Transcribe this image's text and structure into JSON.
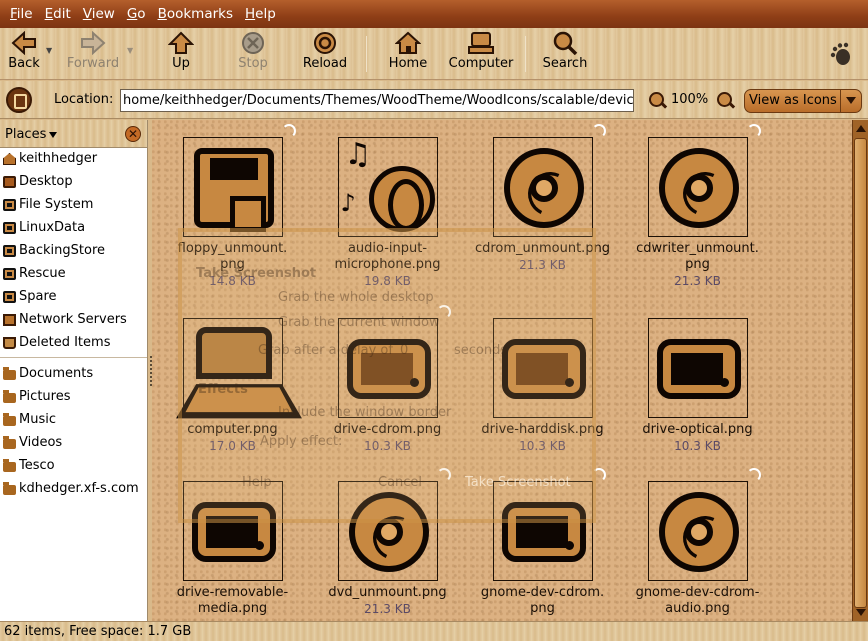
{
  "menubar": {
    "items": [
      {
        "accel": "F",
        "rest": "ile"
      },
      {
        "accel": "E",
        "rest": "dit"
      },
      {
        "accel": "V",
        "rest": "iew"
      },
      {
        "accel": "G",
        "rest": "o"
      },
      {
        "accel": "B",
        "rest": "ookmarks"
      },
      {
        "accel": "H",
        "rest": "elp"
      }
    ]
  },
  "toolbar": {
    "back": "Back",
    "forward": "Forward",
    "up": "Up",
    "stop": "Stop",
    "reload": "Reload",
    "home": "Home",
    "computer": "Computer",
    "search": "Search"
  },
  "location": {
    "label": "Location:",
    "path": "home/keithhedger/Documents/Themes/WoodTheme/WoodIcons/scalable/devices",
    "zoom": "100%",
    "view_mode": "View as Icons"
  },
  "sidebar": {
    "title": "Places",
    "items": [
      {
        "label": "keithhedger",
        "icon": "home-icon"
      },
      {
        "label": "Desktop",
        "icon": "desktop-icon"
      },
      {
        "label": "File System",
        "icon": "drive-icon"
      },
      {
        "label": "LinuxData",
        "icon": "drive-icon"
      },
      {
        "label": "BackingStore",
        "icon": "drive-icon"
      },
      {
        "label": "Rescue",
        "icon": "drive-icon"
      },
      {
        "label": "Spare",
        "icon": "drive-icon"
      },
      {
        "label": "Network Servers",
        "icon": "network-icon"
      },
      {
        "label": "Deleted Items",
        "icon": "trash-icon"
      }
    ],
    "bookmarks": [
      "Documents",
      "Pictures",
      "Music",
      "Videos",
      "Tesco",
      "kdhedger.xf-s.com"
    ]
  },
  "files": [
    {
      "name1": "floppy_unmount.",
      "name2": "png",
      "size": "14.8 KB",
      "icon": "floppy-icon"
    },
    {
      "name1": "audio-input-",
      "name2": "microphone.png",
      "size": "19.8 KB",
      "icon": "audio-icon"
    },
    {
      "name1": "cdrom_unmount.png",
      "name2": "",
      "size": "21.3 KB",
      "icon": "disc-icon"
    },
    {
      "name1": "cdwriter_unmount.",
      "name2": "png",
      "size": "21.3 KB",
      "icon": "disc-icon"
    },
    {
      "name1": "computer.png",
      "name2": "",
      "size": "17.0 KB",
      "icon": "laptop-icon"
    },
    {
      "name1": "drive-cdrom.png",
      "name2": "",
      "size": "10.3 KB",
      "icon": "drive-icon"
    },
    {
      "name1": "drive-harddisk.png",
      "name2": "",
      "size": "10.3 KB",
      "icon": "drive-icon"
    },
    {
      "name1": "drive-optical.png",
      "name2": "",
      "size": "10.3 KB",
      "icon": "drive-icon"
    },
    {
      "name1": "drive-removable-",
      "name2": "media.png",
      "size": "",
      "icon": "drive-icon"
    },
    {
      "name1": "dvd_unmount.png",
      "name2": "",
      "size": "21.3 KB",
      "icon": "disc-icon"
    },
    {
      "name1": "gnome-dev-cdrom.",
      "name2": "png",
      "size": "",
      "icon": "drive-icon"
    },
    {
      "name1": "gnome-dev-cdrom-",
      "name2": "audio.png",
      "size": "",
      "icon": "disc-icon"
    }
  ],
  "ghost_dialog": {
    "title": "Take Screenshot",
    "opt1": "Grab the whole desktop",
    "opt2": "Grab the current window",
    "delay_label": "Grab after a delay of",
    "delay_value": "0",
    "delay_unit": "seconds",
    "effects": "Effects",
    "include_border": "Include the window border",
    "apply_effect": "Apply effect:",
    "help": "Help",
    "cancel": "Cancel",
    "take": "Take Screenshot"
  },
  "status": {
    "text": "62 items, Free space: 1.7 GB"
  }
}
